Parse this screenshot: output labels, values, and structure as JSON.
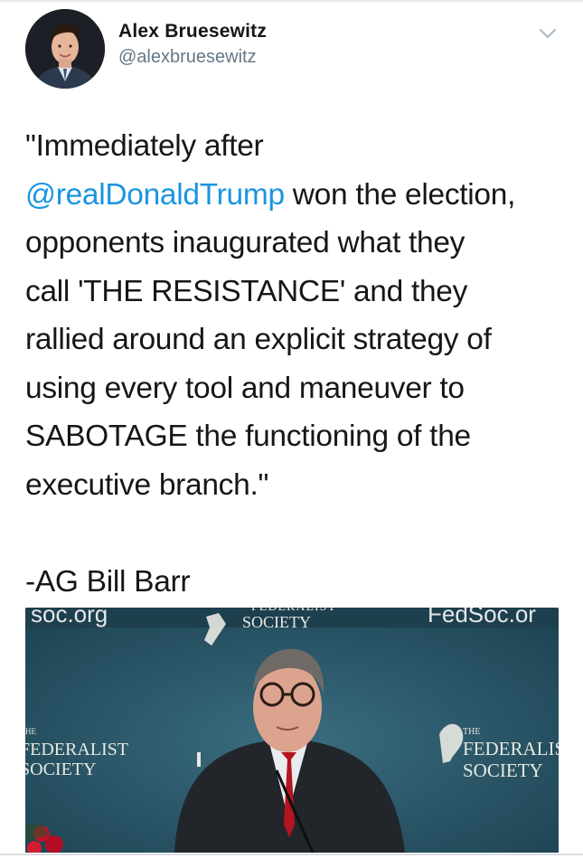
{
  "author": {
    "name": "Alex Bruesewitz",
    "handle": "@alexbruesewitz"
  },
  "tweet": {
    "line_1": "\"Immediately after",
    "mention": "@realDonaldTrump",
    "line_2_rest": " won the election,",
    "line_3": "opponents inaugurated what they",
    "line_4": "call 'THE RESISTANCE' and they",
    "line_5": "rallied around an explicit strategy of",
    "line_6": "using every tool and maneuver to",
    "line_7": "SABOTAGE the functioning of the",
    "line_8": "executive branch.\"",
    "attribution": "-AG Bill Barr"
  },
  "media": {
    "banner_left": "soc.org",
    "banner_right": "FedSoc.or",
    "banner_center_top": "FEDERALIST",
    "banner_center": "SOCIETY",
    "sign_left_small": "HE",
    "sign_left_line1": "FEDERALIST",
    "sign_left_line2": "SOCIETY",
    "sign_right_small": "THE",
    "sign_right_line1": "FEDERALIS",
    "sign_right_line2": "SOCIETY"
  },
  "colors": {
    "mention": "#1b95e0",
    "handle": "#657786",
    "backdrop": "#2b5566"
  },
  "icons": {
    "menu": "chevron-down-icon"
  }
}
